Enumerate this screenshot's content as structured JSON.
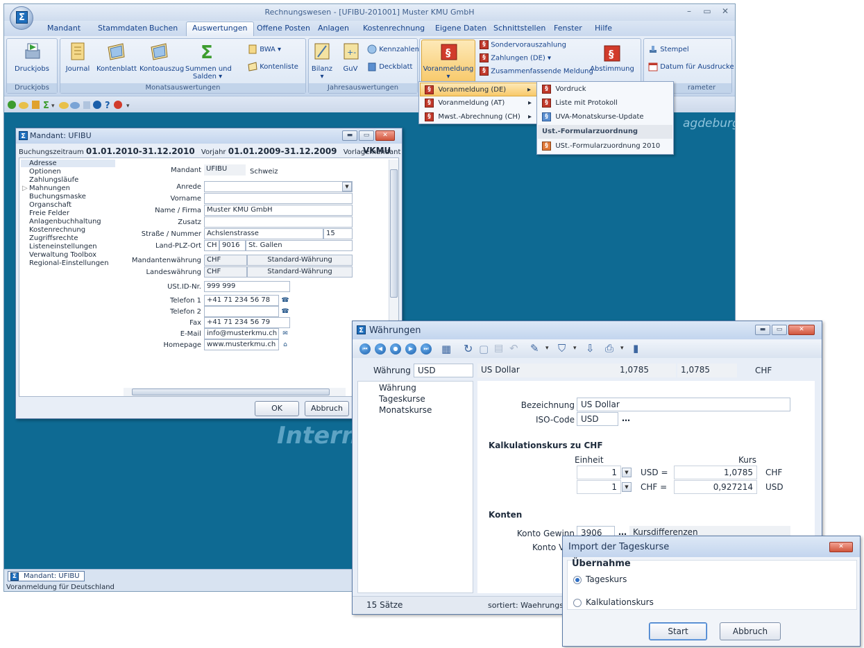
{
  "app": {
    "title": "Rechnungswesen - [UFIBU-201001] Muster KMU GmbH",
    "tabs": [
      "Mandant",
      "Stammdaten",
      "Buchen",
      "Auswertungen",
      "Offene Posten",
      "Anlagen",
      "Kostenrechnung",
      "Eigene Daten",
      "Schnittstellen",
      "Fenster",
      "Hilfe"
    ],
    "active_tab": "Auswertungen"
  },
  "ribbon": {
    "druckjobs": {
      "btn": "Druckjobs",
      "label": "Druckjobs"
    },
    "monat": {
      "journal": "Journal",
      "kontenblatt": "Kontenblatt",
      "kontoauszug": "Kontoauszug",
      "summen1": "Summen und",
      "summen2": "Salden",
      "bwa": "BWA",
      "kontenliste": "Kontenliste",
      "label": "Monatsauswertungen"
    },
    "jahr": {
      "bilanz": "Bilanz",
      "guv": "GuV",
      "kennzahlen": "Kennzahlen",
      "deckblatt": "Deckblatt",
      "label": "Jahresauswertungen"
    },
    "ust": {
      "voranmeldung": "Voranmeldung",
      "sondervoraus": "Sondervorauszahlung",
      "zahlungen": "Zahlungen (DE)",
      "zusammen": "Zusammenfassende Meldung",
      "abstimmung": "Abstimmung"
    },
    "param": {
      "stempel": "Stempel",
      "datum": "Datum für Ausdrucke",
      "label": "rameter"
    }
  },
  "menu1": {
    "items": [
      "Voranmeldung (DE)",
      "Voranmeldung (AT)",
      "Mwst.-Abrechnung (CH)"
    ]
  },
  "menu2": {
    "items": [
      "Vordruck",
      "Liste mit Protokoll",
      "UVA-Monatskurse-Update"
    ],
    "header": "Ust.-Formularzuordnung",
    "item4": "USt.-Formularzuordnung 2010"
  },
  "desktop": {
    "wm_right": "agdeburg",
    "wm_center": "Intern"
  },
  "status": {
    "task": "Mandant: UFIBU",
    "text": "Voranmeldung für Deutschland"
  },
  "mandant": {
    "title": "Mandant: UFIBU",
    "bz_label": "Buchungszeitraum",
    "bz_value": "01.01.2010-31.12.2010",
    "vj_label": "Vorjahr",
    "vj_value": "01.01.2009-31.12.2009",
    "vm_label": "Vorlagemandant",
    "vm_value": "VKMU",
    "nav": [
      "Adresse",
      "Optionen",
      "Zahlungsläufe",
      "Mahnungen",
      "Buchungsmaske",
      "Organschaft",
      "Freie Felder",
      "Anlagenbuchhaltung",
      "Kostenrechnung",
      "Zugriffsrechte",
      "Listeneinstellungen",
      "Verwaltung Toolbox",
      "Regional-Einstellungen"
    ],
    "labels": {
      "mandant": "Mandant",
      "anrede": "Anrede",
      "vorname": "Vorname",
      "name": "Name / Firma",
      "zusatz": "Zusatz",
      "strasse": "Straße / Nummer",
      "land": "Land-PLZ-Ort",
      "mw": "Mandantenwährung",
      "lw": "Landeswährung",
      "ust": "USt.ID-Nr.",
      "tel1": "Telefon 1",
      "tel2": "Telefon 2",
      "fax": "Fax",
      "email": "E-Mail",
      "hp": "Homepage"
    },
    "values": {
      "mandant": "UFIBU",
      "country_name": "Schweiz",
      "anrede": "",
      "vorname": "",
      "name": "Muster KMU GmbH",
      "zusatz": "",
      "strasse": "Achslenstrasse",
      "nummer": "15",
      "land": "CH",
      "plz": "9016",
      "ort": "St. Gallen",
      "mw": "CHF",
      "mw_desc": "Standard-Währung",
      "lw": "CHF",
      "lw_desc": "Standard-Währung",
      "ust": "999 999",
      "tel1": "+41 71 234 56 78",
      "tel2": "",
      "fax": "+41 71 234 56 79",
      "email": "info@musterkmu.ch",
      "hp": "www.musterkmu.ch"
    },
    "ok": "OK",
    "abbruch": "Abbruch"
  },
  "waehrung": {
    "title": "Währungen",
    "label": "Währung",
    "code": "USD",
    "name": "US Dollar",
    "rate1": "1,0785",
    "rate2": "1,0785",
    "base": "CHF",
    "nav": [
      "Währung",
      "Tageskurse",
      "Monatskurse"
    ],
    "bez_label": "Bezeichnung",
    "bez_value": "US Dollar",
    "iso_label": "ISO-Code",
    "iso_value": "USD",
    "kalk_title": "Kalkulationskurs zu CHF",
    "einheit": "Einheit",
    "kurs": "Kurs",
    "row1": {
      "units": "1",
      "eq": "USD =",
      "kurs": "1,0785",
      "cur": "CHF"
    },
    "row2": {
      "units": "1",
      "eq": "CHF =",
      "kurs": "0,927214",
      "cur": "USD"
    },
    "konten_title": "Konten",
    "gewinn_label": "Konto Gewinn",
    "gewinn_value": "3906",
    "gewinn_desc": "Kursdifferenzen",
    "verlust_label": "Konto Verl",
    "status_count": "15 Sätze",
    "status_sort": "sortiert: Waehrungsc"
  },
  "import": {
    "title": "Import der Tageskurse",
    "group": "Übernahme",
    "opt1": "Tageskurs",
    "opt2": "Kalkulationskurs",
    "selected": "Tageskurs",
    "start": "Start",
    "abbruch": "Abbruch"
  },
  "colors": {
    "desktop": "#0e6a93",
    "ribbon": "#d3e0f1",
    "highlight": "#f8c96a"
  }
}
